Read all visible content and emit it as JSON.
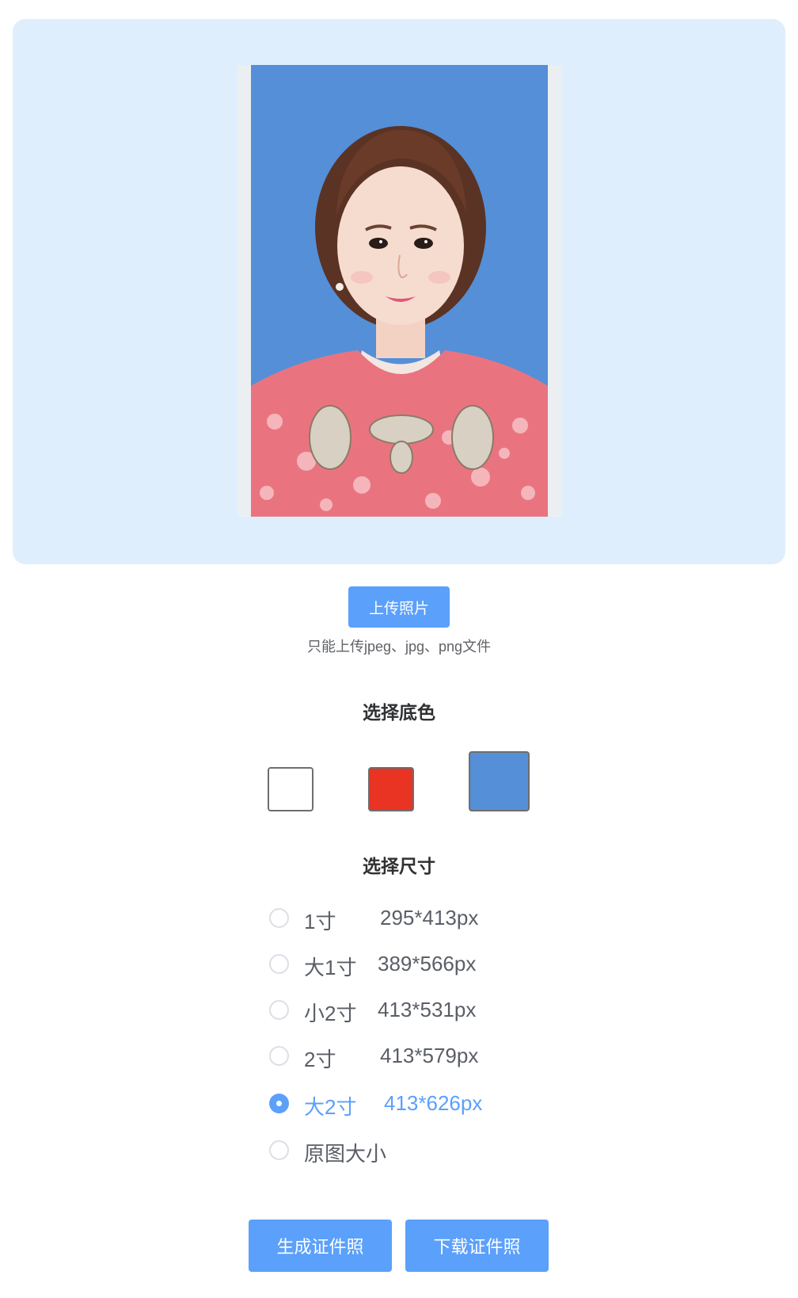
{
  "colors": {
    "accent": "#5ba0fb",
    "panel_bg": "#dfeefd",
    "text_default": "#5a5e66",
    "text_selected": "#5ba0fb"
  },
  "preview": {
    "photo_icon": "id-photo-portrait"
  },
  "upload": {
    "button_label": "上传照片",
    "hint": "只能上传jpeg、jpg、png文件"
  },
  "background": {
    "title": "选择底色",
    "swatches": [
      {
        "name": "white",
        "color": "#ffffff"
      },
      {
        "name": "red",
        "color": "#e93323"
      },
      {
        "name": "blue",
        "color": "#558fd7"
      }
    ]
  },
  "size": {
    "title": "选择尺寸",
    "options": [
      {
        "name": "1寸",
        "dimensions": "295*413px",
        "checked": false
      },
      {
        "name": "大1寸",
        "dimensions": "389*566px",
        "checked": false
      },
      {
        "name": "小2寸",
        "dimensions": "413*531px",
        "checked": false
      },
      {
        "name": "2寸",
        "dimensions": "413*579px",
        "checked": false
      },
      {
        "name": "大2寸",
        "dimensions": "413*626px",
        "checked": true
      },
      {
        "name": "原图大小",
        "dimensions": "",
        "checked": false
      }
    ]
  },
  "actions": {
    "generate_label": "生成证件照",
    "download_label": "下载证件照"
  }
}
